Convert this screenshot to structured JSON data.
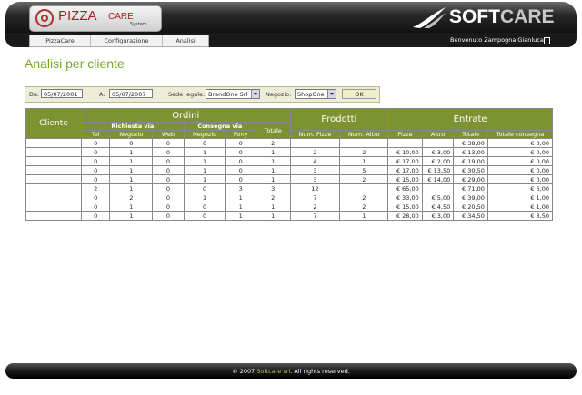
{
  "header": {
    "logo_pizza": "PIZZA",
    "logo_care": "CARE",
    "logo_system": "System",
    "brand_soft": "SOFT",
    "brand_care": "CARE",
    "nav": [
      {
        "label": "PizzaCare"
      },
      {
        "label": "Configurazione"
      },
      {
        "label": "Analisi"
      }
    ],
    "welcome": "Benvenuto Zampogna Gianluca"
  },
  "page_title": "Analisi per cliente",
  "filter": {
    "da_label": "Da:",
    "da_value": "05/07/2001",
    "a_label": "A:",
    "a_value": "05/07/2007",
    "sede_label": "Sede legale:",
    "sede_value": "BrandOne Srl",
    "negozio_label": "Negozio:",
    "negozio_value": "ShopOne",
    "ok_label": "OK"
  },
  "table": {
    "h_cliente": "Cliente",
    "h_ordini": "Ordini",
    "h_prodotti": "Prodotti",
    "h_entrate": "Entrate",
    "h_richiesta": "Richiesta via",
    "h_consegna": "Consegna via",
    "h_totale": "Totale",
    "cols": [
      "Tel",
      "Negozio",
      "Web",
      "Negozio",
      "Pony",
      "Num. Pizze",
      "Num. Altro",
      "Pizze",
      "Altro",
      "Totale",
      "Totale consegna"
    ],
    "rows": [
      {
        "tel": "0",
        "neg": "0",
        "web": "0",
        "cneg": "0",
        "pony": "0",
        "tot": "2",
        "pizze": "",
        "altro": "",
        "epizze": "",
        "ealtro": "",
        "etot": "€ 38,00",
        "econs": "€ 0,00"
      },
      {
        "tel": "0",
        "neg": "1",
        "web": "0",
        "cneg": "1",
        "pony": "0",
        "tot": "1",
        "pizze": "2",
        "altro": "2",
        "epizze": "€ 10,00",
        "ealtro": "€ 3,00",
        "etot": "€ 13,00",
        "econs": "€ 0,00"
      },
      {
        "tel": "0",
        "neg": "1",
        "web": "0",
        "cneg": "1",
        "pony": "0",
        "tot": "1",
        "pizze": "4",
        "altro": "1",
        "epizze": "€ 17,00",
        "ealtro": "€ 2,00",
        "etot": "€ 19,00",
        "econs": "€ 0,00"
      },
      {
        "tel": "0",
        "neg": "1",
        "web": "0",
        "cneg": "1",
        "pony": "0",
        "tot": "1",
        "pizze": "3",
        "altro": "5",
        "epizze": "€ 17,00",
        "ealtro": "€ 13,50",
        "etot": "€ 30,50",
        "econs": "€ 0,00"
      },
      {
        "tel": "0",
        "neg": "1",
        "web": "0",
        "cneg": "1",
        "pony": "0",
        "tot": "1",
        "pizze": "3",
        "altro": "2",
        "epizze": "€ 15,00",
        "ealtro": "€ 14,00",
        "etot": "€ 29,00",
        "econs": "€ 0,00"
      },
      {
        "tel": "2",
        "neg": "1",
        "web": "0",
        "cneg": "0",
        "pony": "3",
        "tot": "3",
        "pizze": "12",
        "altro": "",
        "epizze": "€ 65,00",
        "ealtro": "",
        "etot": "€ 71,00",
        "econs": "€ 6,00"
      },
      {
        "tel": "0",
        "neg": "2",
        "web": "0",
        "cneg": "1",
        "pony": "1",
        "tot": "2",
        "pizze": "7",
        "altro": "2",
        "epizze": "€ 33,00",
        "ealtro": "€ 5,00",
        "etot": "€ 39,00",
        "econs": "€ 1,00"
      },
      {
        "tel": "0",
        "neg": "1",
        "web": "0",
        "cneg": "0",
        "pony": "1",
        "tot": "1",
        "pizze": "2",
        "altro": "2",
        "epizze": "€ 15,00",
        "ealtro": "€ 4,50",
        "etot": "€ 20,50",
        "econs": "€ 1,00"
      },
      {
        "tel": "0",
        "neg": "1",
        "web": "0",
        "cneg": "0",
        "pony": "1",
        "tot": "1",
        "pizze": "7",
        "altro": "1",
        "epizze": "€ 28,00",
        "ealtro": "€ 3,00",
        "etot": "€ 34,50",
        "econs": "€ 3,50"
      }
    ]
  },
  "footer": {
    "prefix": "© 2007 ",
    "link": "Softcare srl",
    "suffix": ". All rights reserved."
  },
  "colors": {
    "accent_green": "#78a82a",
    "table_header": "#7d9332",
    "header_dark": "#1a1a1a"
  }
}
